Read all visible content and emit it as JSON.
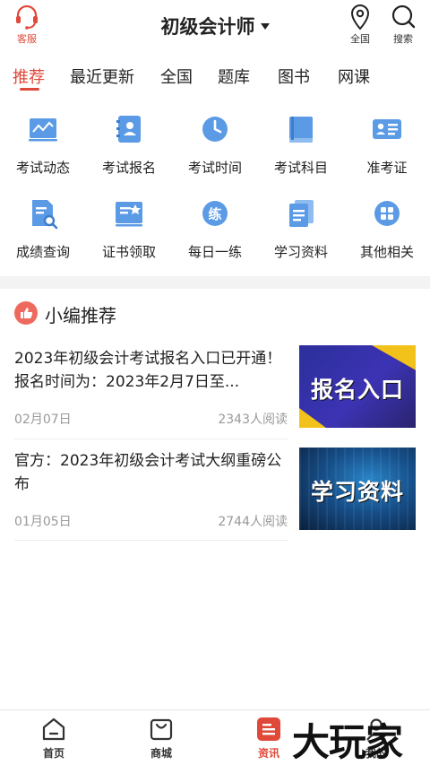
{
  "header": {
    "service_label": "客服",
    "title": "初级会计师",
    "region_label": "全国",
    "search_label": "搜索"
  },
  "tabs": [
    {
      "label": "推荐",
      "active": true
    },
    {
      "label": "最近更新"
    },
    {
      "label": "全国"
    },
    {
      "label": "题库"
    },
    {
      "label": "图书"
    },
    {
      "label": "网课"
    }
  ],
  "grid": [
    {
      "label": "考试动态",
      "icon": "chart-line-icon"
    },
    {
      "label": "考试报名",
      "icon": "contact-book-icon"
    },
    {
      "label": "考试时间",
      "icon": "clock-icon"
    },
    {
      "label": "考试科目",
      "icon": "book-icon"
    },
    {
      "label": "准考证",
      "icon": "id-card-icon"
    },
    {
      "label": "成绩查询",
      "icon": "document-search-icon"
    },
    {
      "label": "证书领取",
      "icon": "certificate-icon"
    },
    {
      "label": "每日一练",
      "icon": "practice-icon",
      "glyph": "练"
    },
    {
      "label": "学习资料",
      "icon": "documents-icon"
    },
    {
      "label": "其他相关",
      "icon": "apps-grid-icon"
    }
  ],
  "section": {
    "title": "小编推荐"
  },
  "articles": [
    {
      "title": "2023年初级会计考试报名入口已开通！报名时间为：2023年2月7日至...",
      "date": "02月07日",
      "reads": "2343人阅读",
      "thumb_text": "报名入口"
    },
    {
      "title": "官方：2023年初级会计考试大纲重磅公布",
      "date": "01月05日",
      "reads": "2744人阅读",
      "thumb_text": "学习资料"
    }
  ],
  "bottom_nav": [
    {
      "label": "首页",
      "icon": "home-icon"
    },
    {
      "label": "商城",
      "icon": "shopping-bag-icon"
    },
    {
      "label": "资讯",
      "icon": "news-icon",
      "active": true
    },
    {
      "label": "我的",
      "icon": "profile-icon"
    }
  ],
  "watermark": "大玩家",
  "colors": {
    "accent": "#e0483a",
    "icon_blue": "#4a8fe0",
    "text": "#222222",
    "muted": "#999999"
  }
}
